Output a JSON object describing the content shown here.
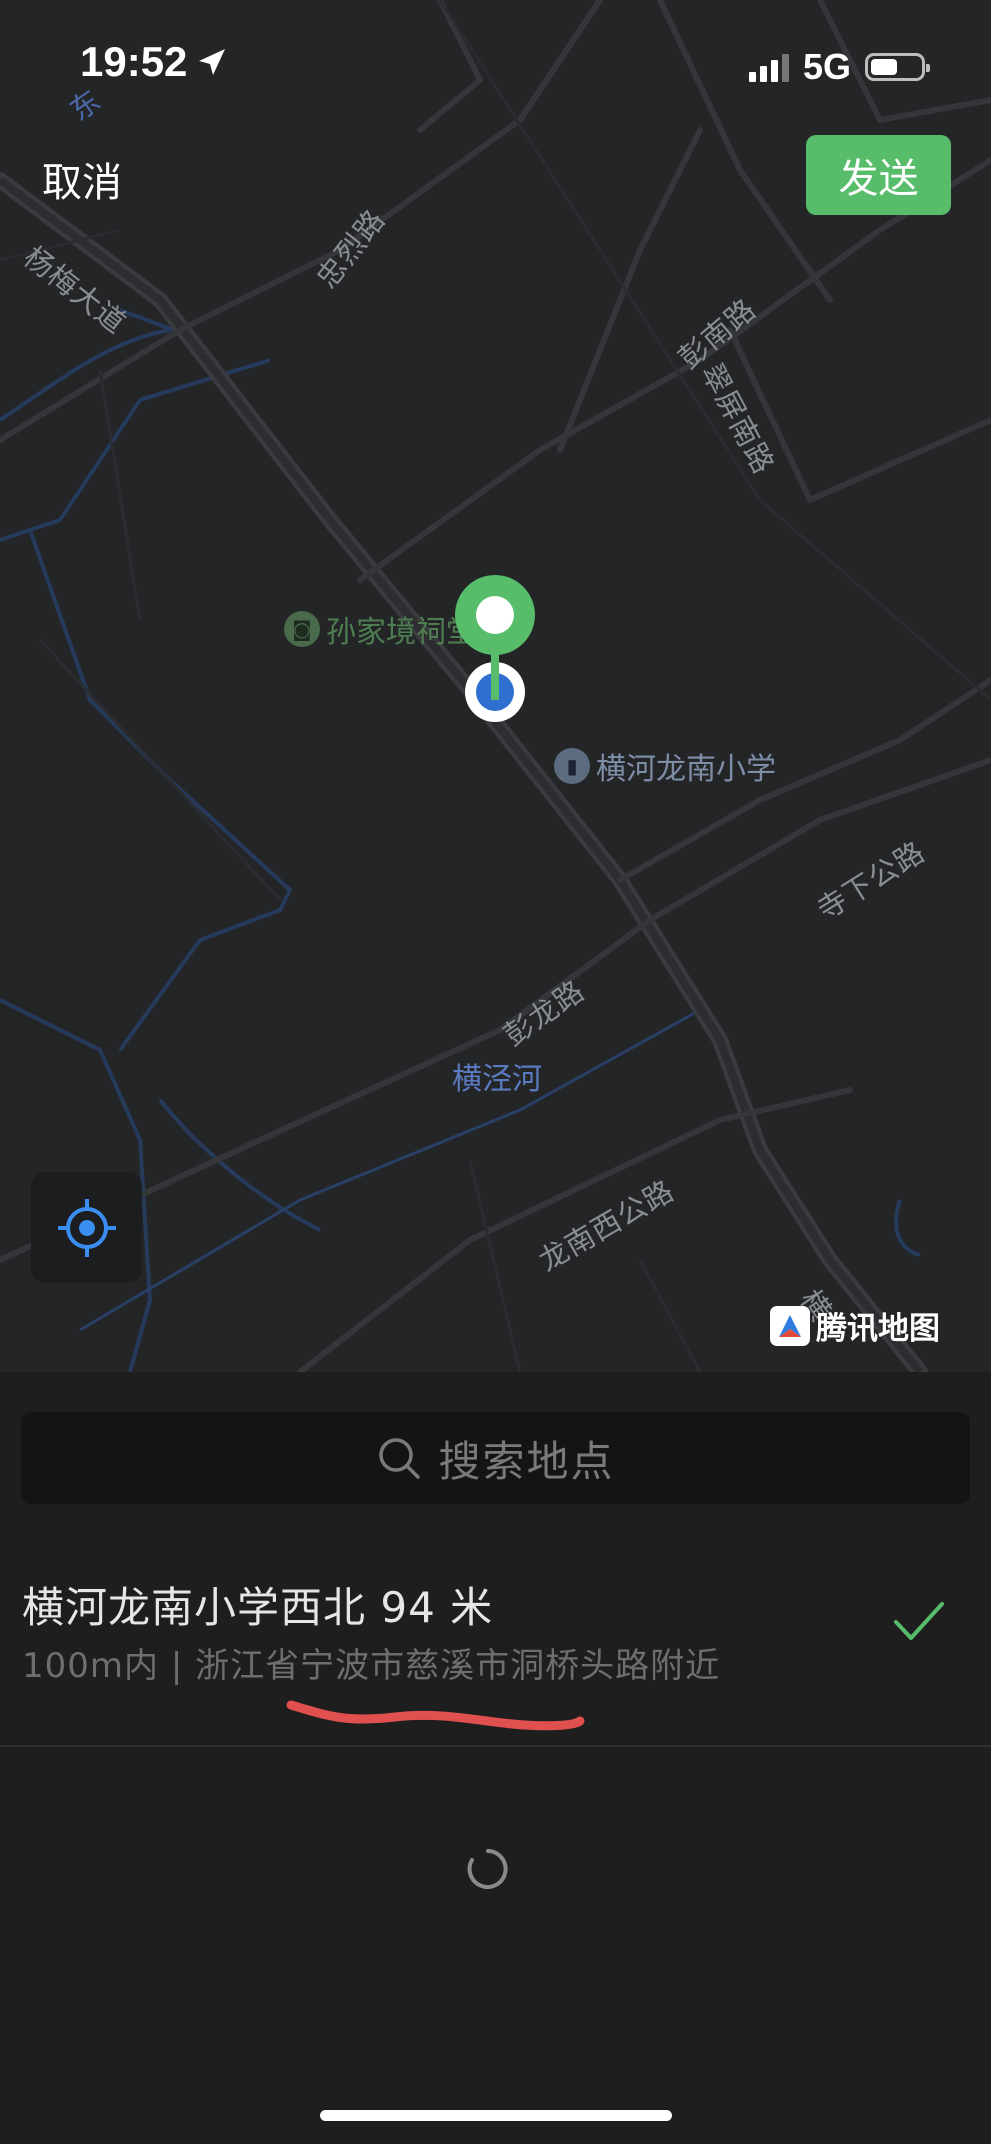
{
  "status_bar": {
    "time": "19:52",
    "network": "5G",
    "battery_level": 0.55
  },
  "top_bar": {
    "cancel_label": "取消",
    "send_label": "发送"
  },
  "map": {
    "road_labels": [
      "东",
      "杨梅大道",
      "忠烈路",
      "彭南路",
      "翠屏南路",
      "寺下公路",
      "彭龙路",
      "龙南西公路",
      "横"
    ],
    "water_labels": [
      "横泾河"
    ],
    "pois": [
      {
        "name": "孙家境祠堂",
        "icon": "camera-icon"
      },
      {
        "name": "横河龙南小学",
        "icon": "book-icon"
      }
    ],
    "provider": "腾讯地图",
    "colors": {
      "background": "#242527",
      "pin": "#57bd6a",
      "location_dot": "#2f6fd0",
      "locate_icon": "#3a8ef0"
    }
  },
  "search": {
    "placeholder": "搜索地点"
  },
  "results": [
    {
      "title": "横河龙南小学西北 94 米",
      "subtitle": "100m内 | 浙江省宁波市慈溪市洞桥头路附近",
      "selected": true
    }
  ],
  "accent_colors": {
    "primary": "#57bd6a",
    "annotation": "#e0504f"
  }
}
